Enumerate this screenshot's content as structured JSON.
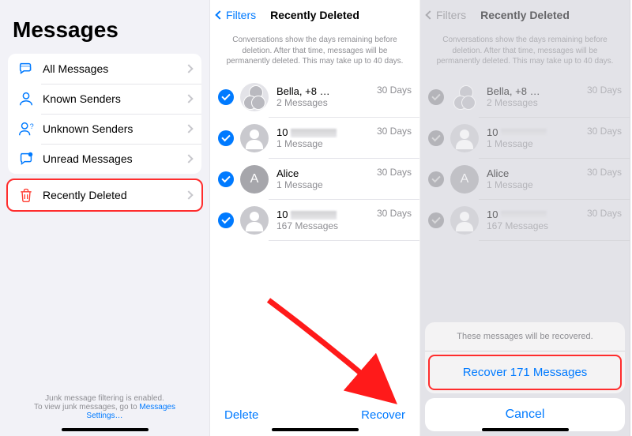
{
  "panel1": {
    "title": "Messages",
    "rows": [
      {
        "label": "All Messages"
      },
      {
        "label": "Known Senders"
      },
      {
        "label": "Unknown Senders"
      },
      {
        "label": "Unread Messages"
      }
    ],
    "highlighted": {
      "label": "Recently Deleted"
    },
    "footer_line1": "Junk message filtering is enabled.",
    "footer_line2a": "To view junk messages, go to ",
    "footer_link": "Messages Settings…"
  },
  "panel2": {
    "back_label": "Filters",
    "title": "Recently Deleted",
    "note": "Conversations show the days remaining before deletion. After that time, messages will be permanently deleted. This may take up to 40 days.",
    "conversations": [
      {
        "name": "Bella, +8",
        "name_trail": "…",
        "sub": "2 Messages",
        "days": "30 Days",
        "avatar": "group"
      },
      {
        "name": "10",
        "sub": "1 Message",
        "days": "30 Days",
        "avatar": "person"
      },
      {
        "name": "Alice",
        "sub": "1 Message",
        "days": "30 Days",
        "avatar": "A"
      },
      {
        "name": "10",
        "sub": "167 Messages",
        "days": "30 Days",
        "avatar": "person"
      }
    ],
    "toolbar": {
      "delete": "Delete",
      "recover": "Recover"
    }
  },
  "panel3": {
    "back_label": "Filters",
    "title": "Recently Deleted",
    "note": "Conversations show the days remaining before deletion. After that time, messages will be permanently deleted. This may take up to 40 days.",
    "sheet": {
      "note": "These messages will be recovered.",
      "recover": "Recover 171 Messages",
      "cancel": "Cancel"
    }
  }
}
